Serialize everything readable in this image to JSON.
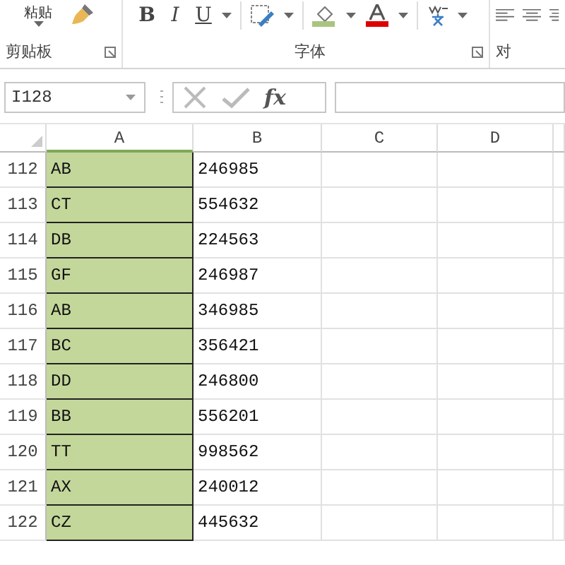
{
  "ribbon": {
    "paste_label": "粘贴",
    "format_buttons": [
      "B",
      "I",
      "U"
    ],
    "groups": [
      {
        "label": "剪贴板",
        "launcher": true
      },
      {
        "label": "字体",
        "launcher": true
      },
      {
        "label": "对",
        "launcher": false
      }
    ]
  },
  "name_box": {
    "value": "I128"
  },
  "formula_bar": {
    "fx": "fx"
  },
  "columns": [
    "A",
    "B",
    "C",
    "D"
  ],
  "rows": [
    {
      "num": "112",
      "a": "AB",
      "b": "246985"
    },
    {
      "num": "113",
      "a": "CT",
      "b": "554632"
    },
    {
      "num": "114",
      "a": "DB",
      "b": "224563"
    },
    {
      "num": "115",
      "a": "GF",
      "b": "246987"
    },
    {
      "num": "116",
      "a": "AB",
      "b": "346985"
    },
    {
      "num": "117",
      "a": "BC",
      "b": "356421"
    },
    {
      "num": "118",
      "a": "DD",
      "b": "246800"
    },
    {
      "num": "119",
      "a": "BB",
      "b": "556201"
    },
    {
      "num": "120",
      "a": "TT",
      "b": "998562"
    },
    {
      "num": "121",
      "a": "AX",
      "b": "240012"
    },
    {
      "num": "122",
      "a": "CZ",
      "b": "445632"
    }
  ]
}
